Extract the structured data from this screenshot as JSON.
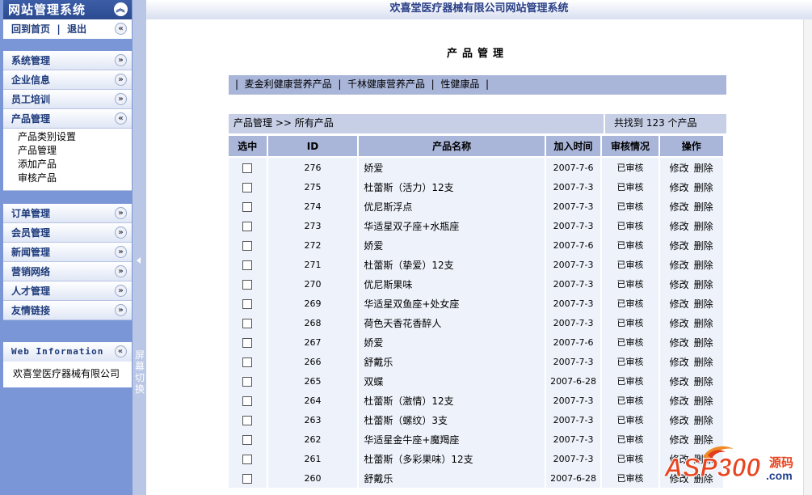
{
  "sidebar": {
    "system_title": "网站管理系统",
    "home_link": "回到首页",
    "separator": "|",
    "logout_link": "退出",
    "menu_group1": [
      {
        "label": "系统管理"
      },
      {
        "label": "企业信息"
      },
      {
        "label": "员工培训"
      },
      {
        "label": "产品管理"
      }
    ],
    "product_submenu": [
      "产品类别设置",
      "产品管理",
      "添加产品",
      "审核产品"
    ],
    "menu_group2": [
      {
        "label": "订单管理"
      },
      {
        "label": "会员管理"
      },
      {
        "label": "新闻管理"
      },
      {
        "label": "营销网络"
      },
      {
        "label": "人才管理"
      },
      {
        "label": "友情链接"
      }
    ],
    "info_title": "Web Information",
    "info_text": "欢喜堂医疗器械有限公司",
    "toggle_text": "屏幕切换"
  },
  "header": {
    "title": "欢喜堂医疗器械有限公司网站管理系统"
  },
  "main": {
    "page_title": "产品管理",
    "categories": [
      "麦金利健康营养产品",
      "千林健康营养产品",
      "性健康品"
    ],
    "breadcrumb": "产品管理 >> 所有产品",
    "count_text": "共找到 123 个产品",
    "columns": [
      "选中",
      "ID",
      "产品名称",
      "加入时间",
      "审核情况",
      "操作"
    ],
    "edit_label": "修改",
    "delete_label": "删除",
    "rows": [
      {
        "id": "276",
        "name": "娇爱",
        "date": "2007-7-6",
        "status": "已审核"
      },
      {
        "id": "275",
        "name": "杜蕾斯（活力）12支",
        "date": "2007-7-3",
        "status": "已审核"
      },
      {
        "id": "274",
        "name": "优尼斯浮点",
        "date": "2007-7-3",
        "status": "已审核"
      },
      {
        "id": "273",
        "name": "华适星双子座+水瓶座",
        "date": "2007-7-3",
        "status": "已审核"
      },
      {
        "id": "272",
        "name": "娇爱",
        "date": "2007-7-6",
        "status": "已审核"
      },
      {
        "id": "271",
        "name": "杜蕾斯（挚爱）12支",
        "date": "2007-7-3",
        "status": "已审核"
      },
      {
        "id": "270",
        "name": "优尼斯果味",
        "date": "2007-7-3",
        "status": "已审核"
      },
      {
        "id": "269",
        "name": "华适星双鱼座+处女座",
        "date": "2007-7-3",
        "status": "已审核"
      },
      {
        "id": "268",
        "name": "荷色天香花香醉人",
        "date": "2007-7-3",
        "status": "已审核"
      },
      {
        "id": "267",
        "name": "娇爱",
        "date": "2007-7-6",
        "status": "已审核"
      },
      {
        "id": "266",
        "name": "舒戴乐",
        "date": "2007-7-3",
        "status": "已审核"
      },
      {
        "id": "265",
        "name": "双蝶",
        "date": "2007-6-28",
        "status": "已审核"
      },
      {
        "id": "264",
        "name": "杜蕾斯（激情）12支",
        "date": "2007-7-3",
        "status": "已审核"
      },
      {
        "id": "263",
        "name": "杜蕾斯（螺纹）3支",
        "date": "2007-7-3",
        "status": "已审核"
      },
      {
        "id": "262",
        "name": "华适星金牛座+魔羯座",
        "date": "2007-7-3",
        "status": "已审核"
      },
      {
        "id": "261",
        "name": "杜蕾斯（多彩果味）12支",
        "date": "2007-7-3",
        "status": "已审核"
      },
      {
        "id": "260",
        "name": "舒戴乐",
        "date": "2007-6-28",
        "status": "已审核"
      }
    ]
  },
  "watermark": {
    "brand": "ASP300",
    "suffix": "源码",
    "domain": ".com"
  },
  "icons": {
    "collapse": "chevron-up-double-icon",
    "expand": "chevron-down-double-icon",
    "left": "chevron-left-double-icon"
  }
}
